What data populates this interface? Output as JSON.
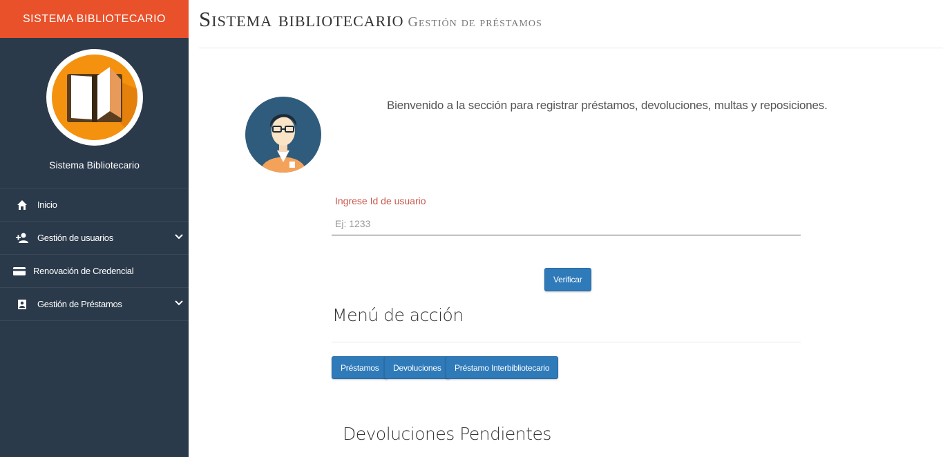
{
  "sidebar": {
    "brand": "SISTEMA BIBLIOTECARIO",
    "profile_name": "Sistema Bibliotecario",
    "items": [
      {
        "label": "Inicio",
        "icon": "home-icon"
      },
      {
        "label": "Gestión de usuarios",
        "icon": "add-user-icon",
        "expandable": true
      },
      {
        "label": "Renovación de Credencial",
        "icon": "credit-card-icon"
      },
      {
        "label": "Gestión de Préstamos",
        "icon": "portrait-icon",
        "expandable": true
      }
    ]
  },
  "header": {
    "title": "Sistema bibliotecario",
    "subtitle": "Gestión de préstamos"
  },
  "main": {
    "welcome": "Bienvenido a la sección para registrar préstamos, devoluciones, multas y reposiciones.",
    "user_field": {
      "label": "Ingrese Id de usuario",
      "placeholder": "Ej: 1233"
    },
    "verify_label": "Verificar",
    "action_menu_title": "Menú de acción",
    "actions": [
      "Préstamos",
      "Devoluciones",
      "Préstamo Interbibliotecario"
    ],
    "pending_title": "Devoluciones Pendientes"
  },
  "colors": {
    "brand": "#e8512a",
    "sidebar": "#2b3a4a",
    "button": "#2f7ab9",
    "field_label": "#c9574b"
  }
}
